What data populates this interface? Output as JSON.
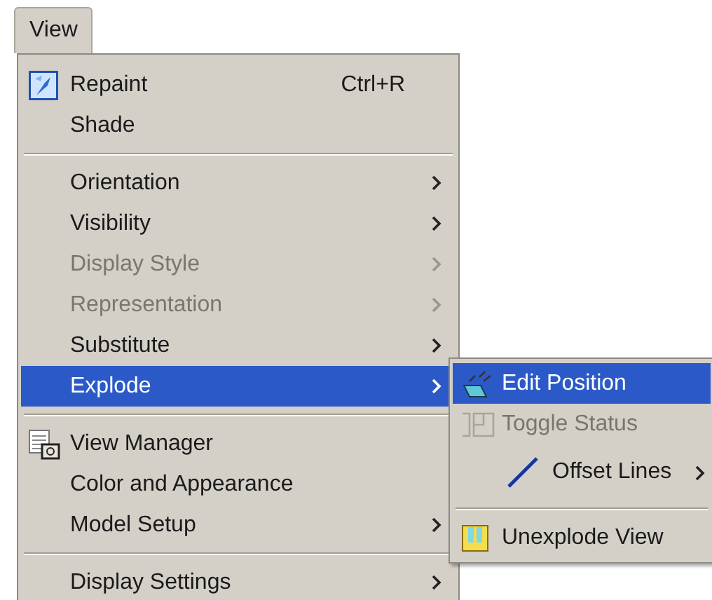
{
  "menu_bar": [
    {
      "label": "View",
      "open": true
    }
  ],
  "menu": [
    {
      "kind": "item",
      "label": "Repaint",
      "shortcut": "Ctrl+R",
      "disabled": false,
      "selected": false,
      "submenu": false
    },
    {
      "kind": "item",
      "label": "Shade",
      "disabled": false,
      "selected": false,
      "submenu": false
    },
    {
      "kind": "separator"
    },
    {
      "kind": "item",
      "label": "Orientation",
      "disabled": false,
      "selected": false,
      "submenu": true
    },
    {
      "kind": "item",
      "label": "Visibility",
      "disabled": false,
      "selected": false,
      "submenu": true
    },
    {
      "kind": "item",
      "label": "Display Style",
      "disabled": true,
      "selected": false,
      "submenu": true
    },
    {
      "kind": "item",
      "label": "Representation",
      "disabled": true,
      "selected": false,
      "submenu": true
    },
    {
      "kind": "item",
      "label": "Substitute",
      "disabled": false,
      "selected": false,
      "submenu": true
    },
    {
      "kind": "item",
      "label": "Explode",
      "disabled": false,
      "selected": true,
      "submenu": true
    },
    {
      "kind": "separator"
    },
    {
      "kind": "item",
      "label": "View Manager",
      "disabled": false,
      "selected": false,
      "submenu": false
    },
    {
      "kind": "item",
      "label": "Color and Appearance",
      "disabled": false,
      "selected": false,
      "submenu": false
    },
    {
      "kind": "item",
      "label": "Model Setup",
      "disabled": false,
      "selected": false,
      "submenu": true
    },
    {
      "kind": "separator"
    },
    {
      "kind": "item",
      "label": "Display Settings",
      "disabled": false,
      "selected": false,
      "submenu": true
    }
  ],
  "submenu": [
    {
      "kind": "item",
      "label": "Edit Position",
      "disabled": false,
      "selected": true,
      "submenu": false
    },
    {
      "kind": "item",
      "label": "Toggle Status",
      "disabled": true,
      "selected": false,
      "submenu": false
    },
    {
      "kind": "item",
      "label": "Offset Lines",
      "disabled": false,
      "selected": false,
      "submenu": true
    },
    {
      "kind": "separator"
    },
    {
      "kind": "item",
      "label": "Unexplode View",
      "disabled": false,
      "selected": false,
      "submenu": false
    }
  ]
}
